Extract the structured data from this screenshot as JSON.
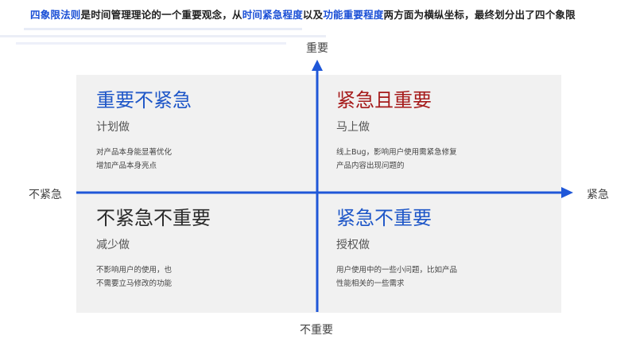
{
  "headline": {
    "term": "四象限法则",
    "part1": "是时间管理理论的一个重要观念，从",
    "urgency": "时间紧急程度",
    "part2": "以及",
    "importance": "功能重要程度",
    "part3": "两方面为横纵坐标，最终划分出了四个象限"
  },
  "axes": {
    "top": "重要",
    "bottom": "不重要",
    "left": "不紧急",
    "right": "紧急"
  },
  "quadrants": {
    "top_left": {
      "title": "重要不紧急",
      "action": "计划做",
      "desc1": "对产品本身能显著优化",
      "desc2": "增加产品本身亮点"
    },
    "top_right": {
      "title": "紧急且重要",
      "action": "马上做",
      "desc1": "线上Bug，影响用户使用需紧急修复",
      "desc2": "产品内容出现问题的"
    },
    "bottom_left": {
      "title": "不紧急不重要",
      "action": "减少做",
      "desc1": "不影响用户的使用，也",
      "desc2": "不需要立马修改的功能"
    },
    "bottom_right": {
      "title": "紧急不重要",
      "action": "授权做",
      "desc1": "用户使用中的一些小问题，比如产品",
      "desc2": "性能相关的一些需求"
    }
  },
  "colors": {
    "axis": "#1f57d8",
    "highlight": "#1a4fd6",
    "title_blue": "#1f57c8",
    "title_red": "#a61c1c",
    "title_dark": "#2b2b2b",
    "panel": "#f1f1f1"
  }
}
